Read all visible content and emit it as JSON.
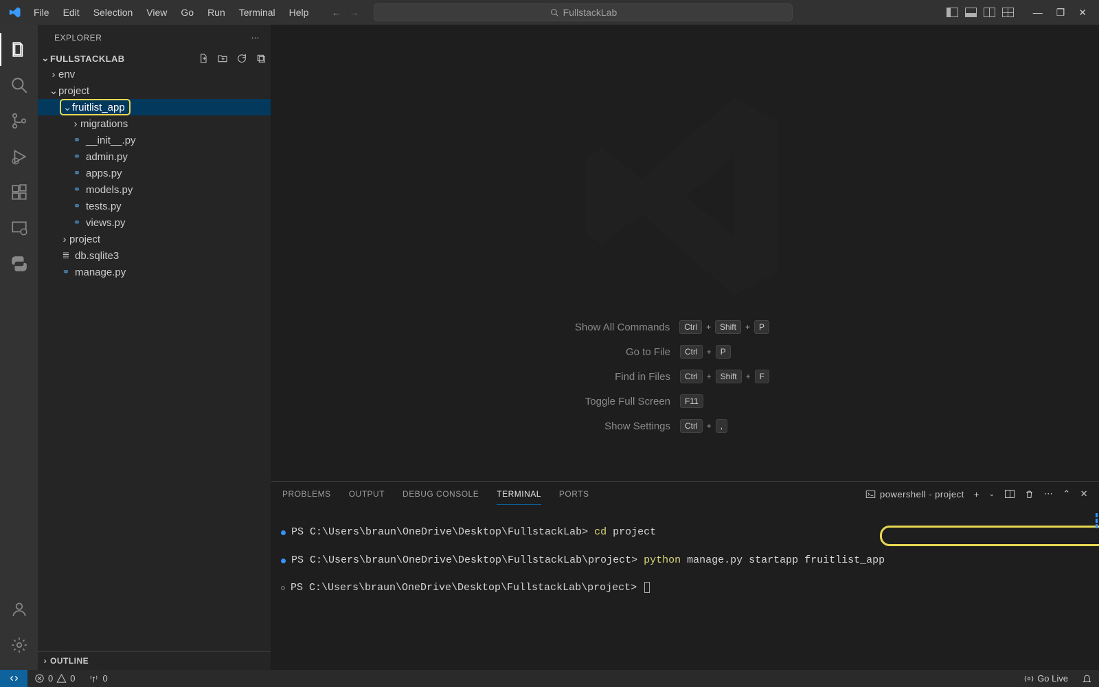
{
  "titlebar": {
    "menu": [
      "File",
      "Edit",
      "Selection",
      "View",
      "Go",
      "Run",
      "Terminal",
      "Help"
    ],
    "search_placeholder": "FullstackLab"
  },
  "sidebar": {
    "title": "EXPLORER",
    "workspace": "FULLSTACKLAB",
    "tree": {
      "env": "env",
      "project": "project",
      "fruitlist_app": "fruitlist_app",
      "migrations": "migrations",
      "init": "__init__.py",
      "admin": "admin.py",
      "apps": "apps.py",
      "models": "models.py",
      "tests": "tests.py",
      "views": "views.py",
      "inner_project": "project",
      "db": "db.sqlite3",
      "manage": "manage.py"
    },
    "outline": "OUTLINE"
  },
  "welcome": {
    "rows": [
      {
        "label": "Show All Commands",
        "keys": [
          "Ctrl",
          "Shift",
          "P"
        ]
      },
      {
        "label": "Go to File",
        "keys": [
          "Ctrl",
          "P"
        ]
      },
      {
        "label": "Find in Files",
        "keys": [
          "Ctrl",
          "Shift",
          "F"
        ]
      },
      {
        "label": "Toggle Full Screen",
        "keys": [
          "F11"
        ]
      },
      {
        "label": "Show Settings",
        "keys": [
          "Ctrl",
          ","
        ]
      }
    ]
  },
  "panel": {
    "tabs": [
      "PROBLEMS",
      "OUTPUT",
      "DEBUG CONSOLE",
      "TERMINAL",
      "PORTS"
    ],
    "terminal_label": "powershell - project",
    "lines": {
      "p1": "PS C:\\Users\\braun\\OneDrive\\Desktop\\FullstackLab>",
      "c1a": "cd",
      "c1b": "project",
      "p2": "PS C:\\Users\\braun\\OneDrive\\Desktop\\FullstackLab\\project>",
      "c2a": "python",
      "c2b": "manage.py startapp fruitlist_app",
      "p3": "PS C:\\Users\\braun\\OneDrive\\Desktop\\FullstackLab\\project>"
    }
  },
  "statusbar": {
    "errors": "0",
    "warnings": "0",
    "ports": "0",
    "golive": "Go Live"
  }
}
